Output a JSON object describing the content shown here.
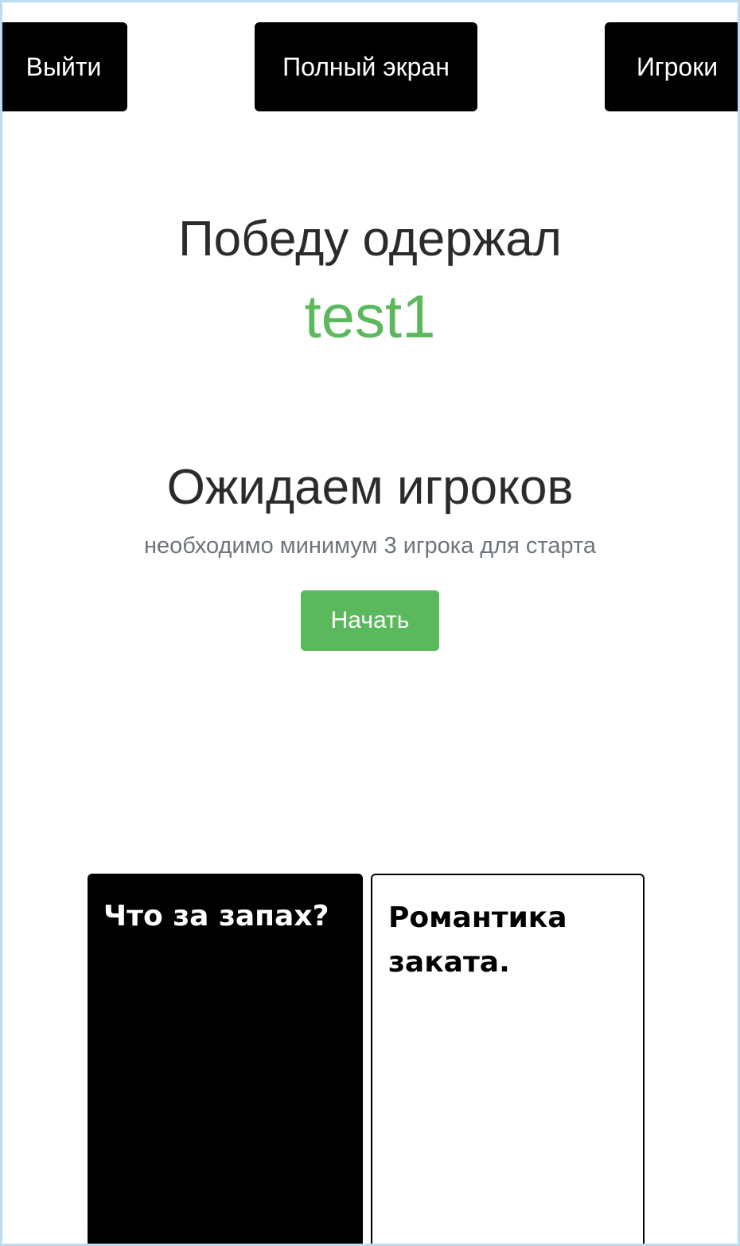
{
  "toolbar": {
    "exit_label": "Выйти",
    "fullscreen_label": "Полный экран",
    "players_label": "Игроки"
  },
  "winner": {
    "title": "Победу одержал",
    "name": "test1"
  },
  "waiting": {
    "title": "Ожидаем игроков",
    "subtitle": "необходимо минимум 3 игрока для старта",
    "start_label": "Начать"
  },
  "cards": {
    "black_card_text": "Что за запах?",
    "white_card_text": "Романтика заката."
  },
  "colors": {
    "accent_green": "#5cb85c",
    "card_black": "#000000",
    "text_muted": "#6c757d",
    "heading": "#2b2b2b"
  }
}
